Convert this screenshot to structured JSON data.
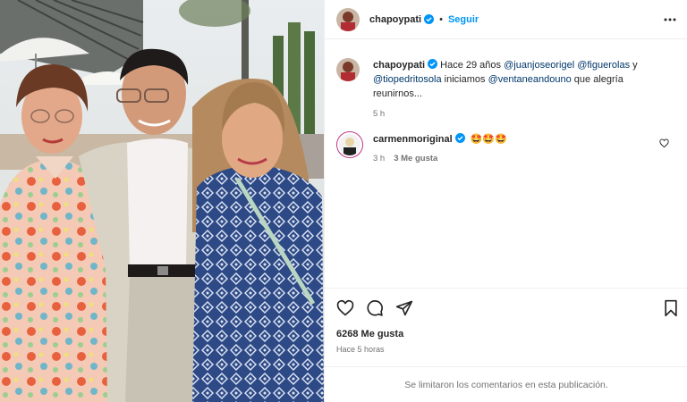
{
  "post": {
    "username": "chapoypati",
    "follow_label": "Seguir",
    "separator": "•"
  },
  "caption": {
    "username": "chapoypati",
    "text_1": "Hace 29 años",
    "mention_1": "@juanjoseorigel",
    "mention_2": "@figuerolas",
    "text_2": "y",
    "mention_3": "@tiopedritosola",
    "text_3": "iniciamos",
    "mention_4": "@ventaneandouno",
    "text_4": "que alegría reunirnos...",
    "time": "5 h"
  },
  "comment": {
    "username": "carmenmoriginal",
    "text": "🤩🤩🤩",
    "time": "3 h",
    "likes": "3 Me gusta"
  },
  "stats": {
    "likes": "6268 Me gusta",
    "posted": "Hace 5 horas"
  },
  "footer": {
    "notice": "Se limitaron los comentarios en esta publicación."
  },
  "colors": {
    "accent": "#0095f6",
    "mention": "#00376b",
    "muted": "#737373",
    "verified": "#0095f6"
  }
}
